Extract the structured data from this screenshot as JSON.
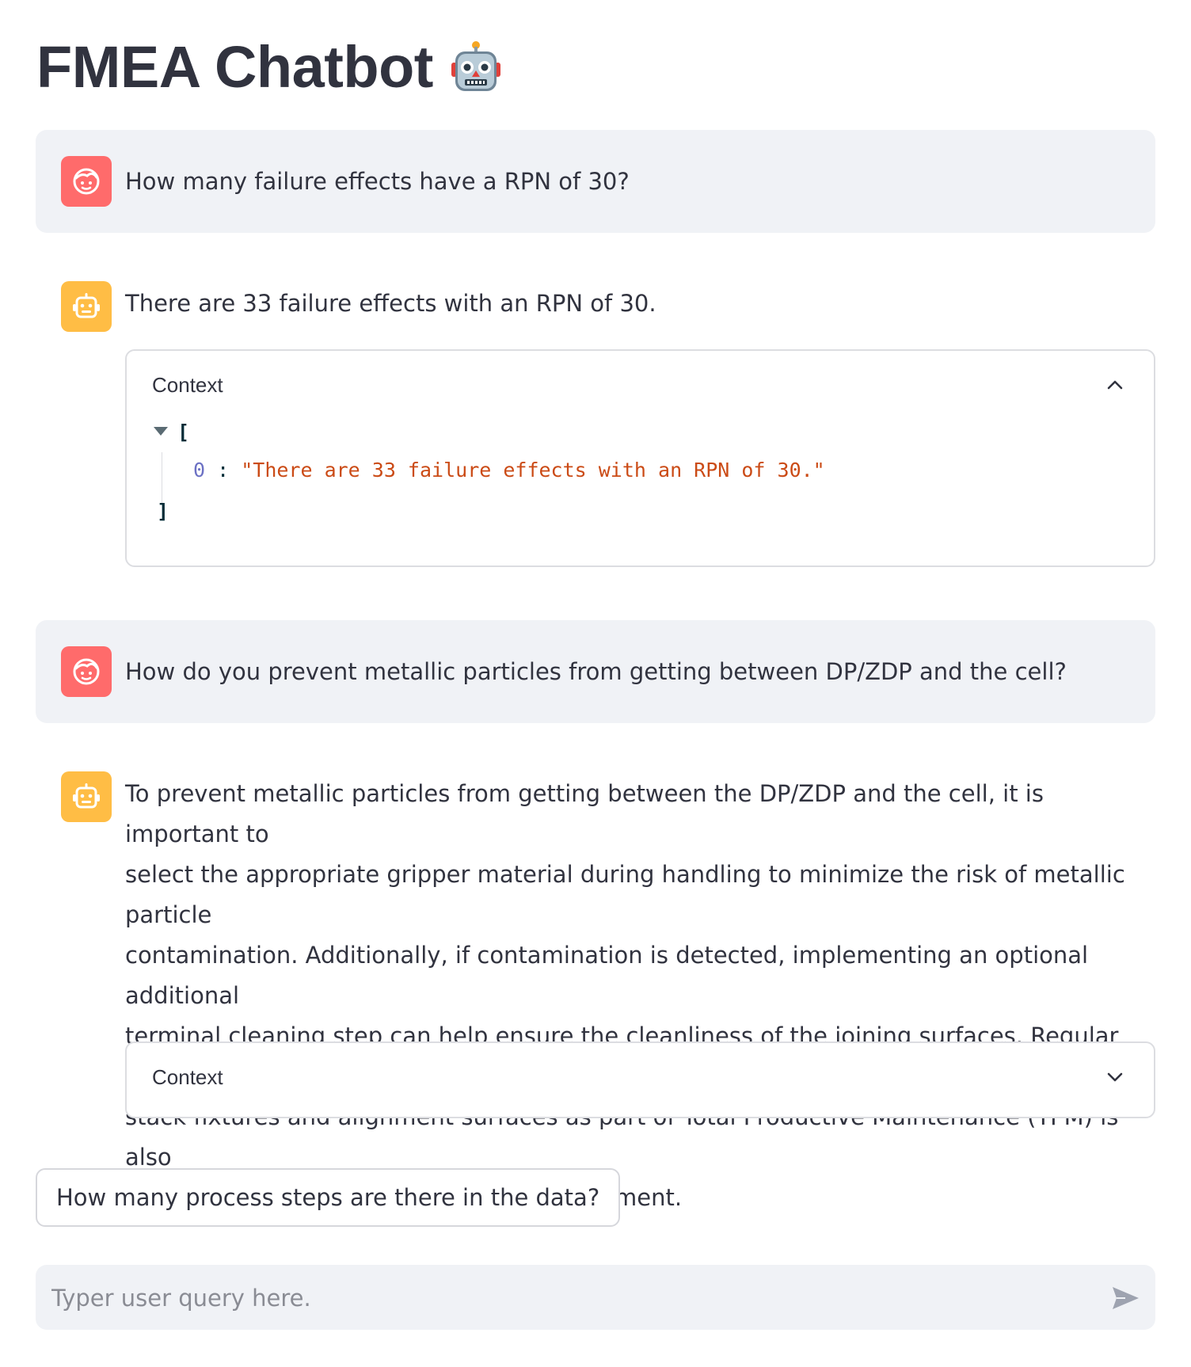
{
  "app": {
    "title": "FMEA Chatbot",
    "title_icon": "robot-emoji"
  },
  "messages": [
    {
      "role": "user",
      "avatar_icon": "user-face-icon",
      "text": "How many failure effects have a RPN of 30?"
    },
    {
      "role": "assistant",
      "avatar_icon": "bot-icon",
      "text": "There are 33 failure effects with an RPN of 30.",
      "context": {
        "label": "Context",
        "expanded": true,
        "json_open": "[",
        "json_close": "]",
        "items": [
          {
            "index": "0",
            "value": "\"There are 33 failure effects with an RPN of 30.\""
          }
        ]
      }
    },
    {
      "role": "user",
      "avatar_icon": "user-face-icon",
      "text": "How do you prevent metallic particles from getting between DP/ZDP and the cell?"
    },
    {
      "role": "assistant",
      "avatar_icon": "bot-icon",
      "lines": [
        "To prevent metallic particles from getting between the DP/ZDP and the cell, it is important to",
        "select the appropriate gripper material during handling to minimize the risk of metallic particle",
        "contamination. Additionally, if contamination is detected, implementing an optional additional",
        "terminal cleaning step can help ensure the cleanliness of the joining surfaces. Regular cleaning of",
        "stack fixtures and alignment surfaces as part of Total Productive Maintenance (TPM) is also",
        "recommended to maintain a clean environment."
      ],
      "context": {
        "label": "Context",
        "expanded": false
      }
    }
  ],
  "suggestion": {
    "label": "How many process steps are there in the data?"
  },
  "chat_input": {
    "placeholder": "Typer user query here.",
    "value": "",
    "send_icon": "send-icon"
  },
  "colors": {
    "user_avatar": "#ff6b6b",
    "bot_avatar": "#ffbd45",
    "message_bg": "#f0f2f6",
    "text": "#31333f",
    "json_key": "#6c71c4",
    "json_string": "#cb4b16"
  }
}
